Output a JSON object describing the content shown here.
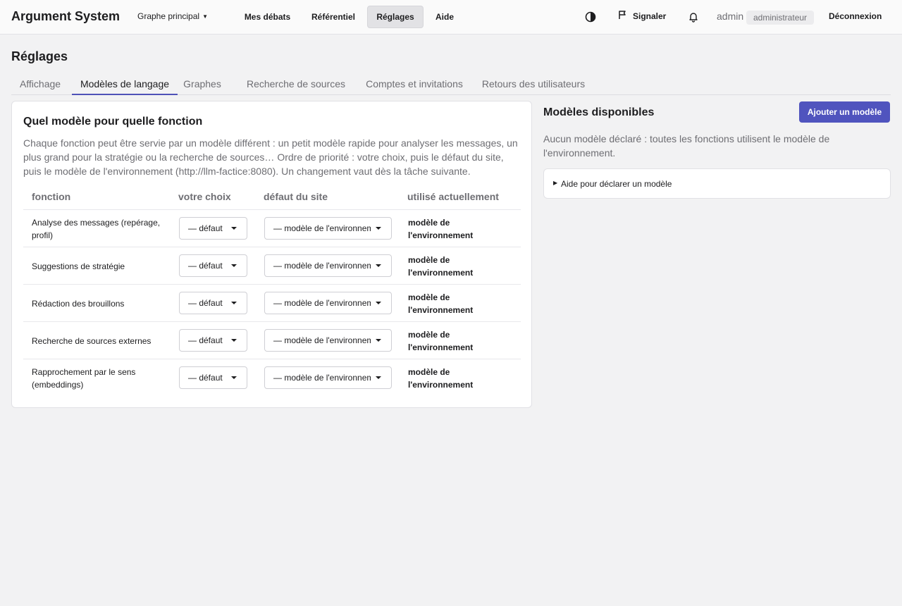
{
  "header": {
    "brand": "Argument System",
    "graph_selector": "Graphe principal",
    "nav": [
      {
        "label": "Mes débats",
        "active": false
      },
      {
        "label": "Référentiel",
        "active": false
      },
      {
        "label": "Réglages",
        "active": true
      },
      {
        "label": "Aide",
        "active": false
      }
    ],
    "theme_icon": "contrast-icon",
    "report_label": "Signaler",
    "report_icon": "flag-icon",
    "notification_icon": "bell-icon",
    "user": "admin",
    "role": "administrateur",
    "logout_label": "Déconnexion"
  },
  "page": {
    "title": "Réglages",
    "tabs": [
      {
        "label": "Affichage",
        "active": false
      },
      {
        "label": "Modèles de langage",
        "active": true
      },
      {
        "label": "Graphes",
        "active": false
      },
      {
        "label": "Recherche de sources",
        "active": false
      },
      {
        "label": "Comptes et invitations",
        "active": false
      },
      {
        "label": "Retours des utilisateurs",
        "active": false
      }
    ]
  },
  "models_card": {
    "title": "Quel modèle pour quelle fonction",
    "description": "Chaque fonction peut être servie par un modèle différent : un petit modèle rapide pour analyser les messages, un plus grand pour la stratégie ou la recherche de sources… Ordre de priorité : votre choix, puis le défaut du site, puis le modèle de l'environnement (http://llm-factice:8080). Un changement vaut dès la tâche suivante.",
    "columns": [
      "fonction",
      "votre choix",
      "défaut du site",
      "utilisé actuellement"
    ],
    "rows": [
      {
        "function": "Analyse des messages (repérage, profil)",
        "choice": "— défaut du site —",
        "site_default": "— modèle de l'environnement —",
        "used": "modèle de l'environnement"
      },
      {
        "function": "Suggestions de stratégie",
        "choice": "— défaut du site —",
        "site_default": "— modèle de l'environnement —",
        "used": "modèle de l'environnement"
      },
      {
        "function": "Rédaction des brouillons",
        "choice": "— défaut du site —",
        "site_default": "— modèle de l'environnement —",
        "used": "modèle de l'environnement"
      },
      {
        "function": "Recherche de sources externes",
        "choice": "— défaut du site —",
        "site_default": "— modèle de l'environnement —",
        "used": "modèle de l'environnement"
      },
      {
        "function": "Rapprochement par le sens (embeddings)",
        "choice": "— défaut du site —",
        "site_default": "— modèle de l'environnement —",
        "used": "modèle de l'environnement"
      }
    ]
  },
  "available_models": {
    "title": "Modèles disponibles",
    "add_button": "Ajouter un modèle",
    "empty_text": "Aucun modèle déclaré : toutes les fonctions utilisent le modèle de l'environnement.",
    "help_label": "Aide pour déclarer un modèle"
  },
  "colors": {
    "accent": "#5054be",
    "background": "#f2f2f3"
  }
}
